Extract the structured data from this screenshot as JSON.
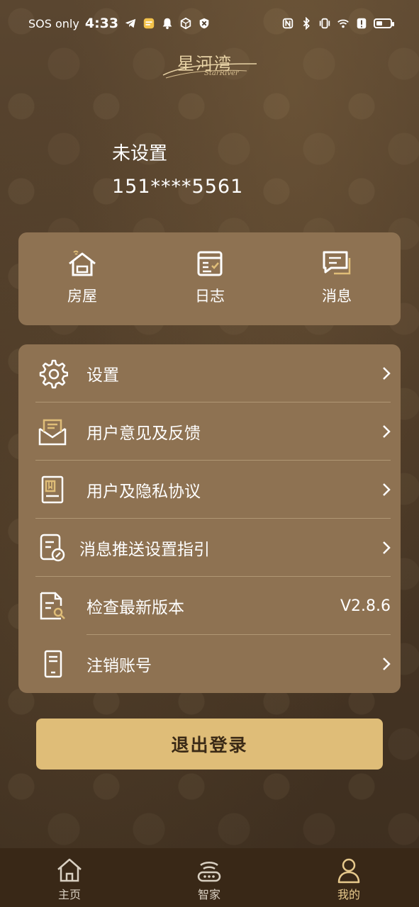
{
  "status_bar": {
    "carrier": "SOS only",
    "time": "4:33"
  },
  "logo": {
    "text": "星河湾",
    "subtitle": "StarRiver"
  },
  "profile": {
    "name": "未设置",
    "phone": "151****5561"
  },
  "quick_actions": [
    {
      "label": "房屋",
      "icon": "house-icon"
    },
    {
      "label": "日志",
      "icon": "log-icon"
    },
    {
      "label": "消息",
      "icon": "message-icon"
    }
  ],
  "menu": [
    {
      "label": "设置",
      "icon": "gear-icon",
      "value": ""
    },
    {
      "label": "用户意见及反馈",
      "icon": "feedback-envelope-icon",
      "value": ""
    },
    {
      "label": "用户及隐私协议",
      "icon": "agreement-document-icon",
      "value": ""
    },
    {
      "label": "消息推送设置指引",
      "icon": "push-settings-icon",
      "value": ""
    },
    {
      "label": "检查最新版本",
      "icon": "document-search-icon",
      "value": "V2.8.6"
    },
    {
      "label": "注销账号",
      "icon": "phone-device-icon",
      "value": ""
    }
  ],
  "logout_label": "退出登录",
  "bottom_nav": [
    {
      "label": "主页",
      "icon": "home-icon",
      "active": false
    },
    {
      "label": "智家",
      "icon": "smart-home-icon",
      "active": false
    },
    {
      "label": "我的",
      "icon": "profile-icon",
      "active": true
    }
  ],
  "colors": {
    "accent_gold": "#dfbd78",
    "card": "#8e7252",
    "nav_bg": "#392817",
    "active_nav": "#e7c98c"
  }
}
